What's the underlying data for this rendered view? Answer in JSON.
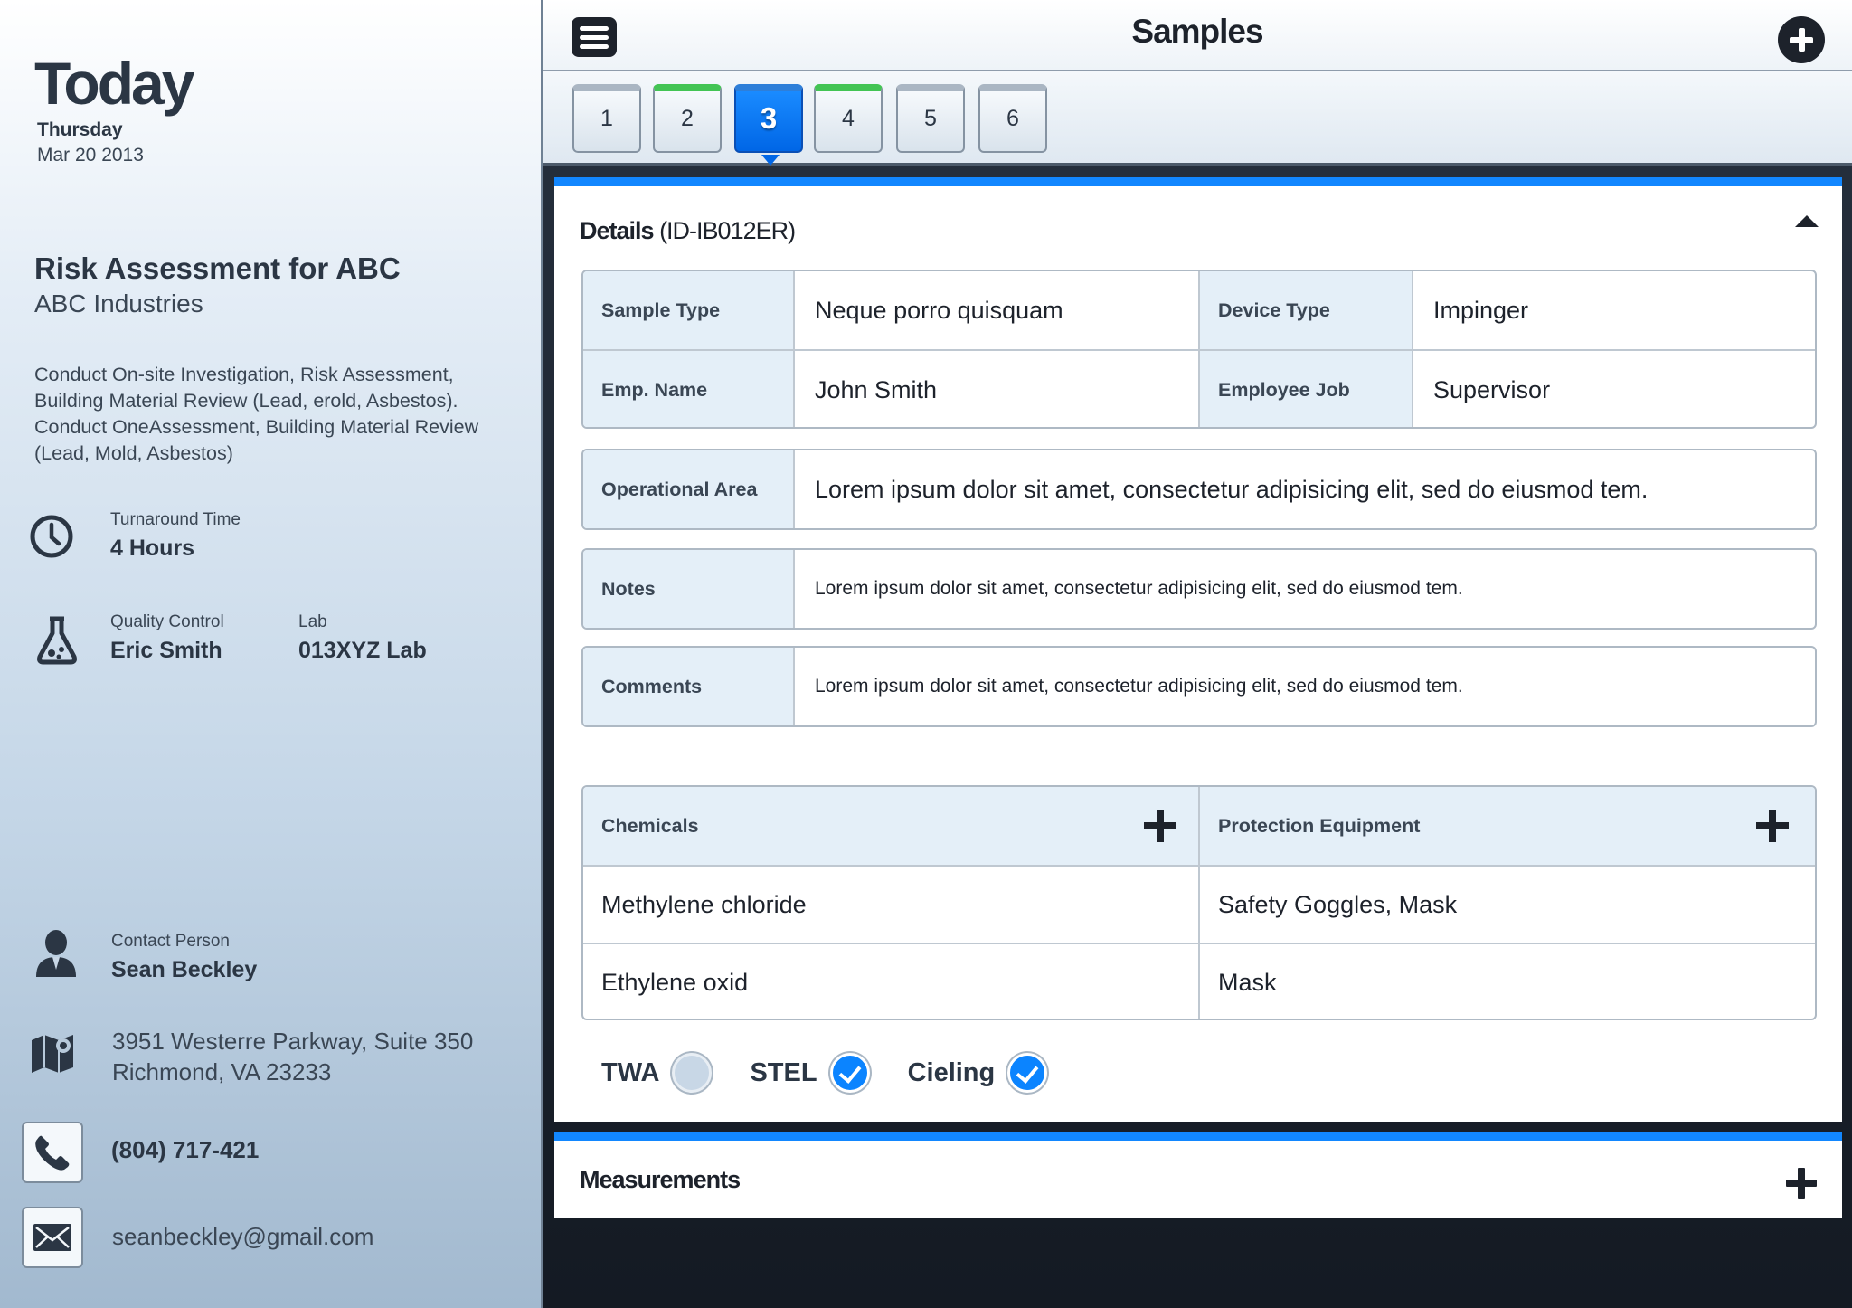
{
  "sidebar": {
    "today": "Today",
    "weekday": "Thursday",
    "date": "Mar 20 2013",
    "project_title": "Risk Assessment for ABC",
    "company": "ABC Industries",
    "description": "Conduct On-site Investigation, Risk Assessment, Building Material Review (Lead, erold, Asbestos). Conduct OneAssessment, Building Material Review (Lead, Mold, Asbestos)",
    "turnaround": {
      "label": "Turnaround Time",
      "value": "4 Hours",
      "icon": "clock-icon"
    },
    "quality_control": {
      "label": "Quality Control",
      "value": "Eric Smith",
      "icon": "flask-icon"
    },
    "lab": {
      "label": "Lab",
      "value": "013XYZ Lab"
    },
    "contact": {
      "label": "Contact Person",
      "value": "Sean Beckley",
      "icon": "person-icon"
    },
    "address_line1": "3951 Westerre Parkway, Suite 350",
    "address_line2": "Richmond, VA 23233",
    "phone": "(804) 717-421",
    "email": "seanbeckley@gmail.com"
  },
  "header": {
    "title": "Samples"
  },
  "tabs": [
    {
      "label": "1",
      "status": "none"
    },
    {
      "label": "2",
      "status": "done"
    },
    {
      "label": "3",
      "status": "active"
    },
    {
      "label": "4",
      "status": "done"
    },
    {
      "label": "5",
      "status": "none"
    },
    {
      "label": "6",
      "status": "none"
    }
  ],
  "details": {
    "title": "Details",
    "id": "(ID-IB012ER)",
    "sample_type_label": "Sample Type",
    "sample_type_value": "Neque porro quisquam",
    "device_type_label": "Device Type",
    "device_type_value": "Impinger",
    "emp_name_label": "Emp. Name",
    "emp_name_value": "John Smith",
    "employee_job_label": "Employee Job",
    "employee_job_value": "Supervisor",
    "operational_area_label": "Operational Area",
    "operational_area_value": "Lorem ipsum dolor sit amet, consectetur adipisicing elit, sed do eiusmod tem.",
    "notes_label": "Notes",
    "notes_value": "Lorem ipsum dolor sit amet, consectetur adipisicing elit, sed do eiusmod tem.",
    "comments_label": "Comments",
    "comments_value": "Lorem ipsum dolor sit amet, consectetur adipisicing elit, sed do eiusmod tem.",
    "chemicals_header": "Chemicals",
    "protection_header": "Protection Equipment",
    "rows": [
      {
        "chemical": "Methylene chloride",
        "protection": "Safety Goggles, Mask"
      },
      {
        "chemical": "Ethylene oxid",
        "protection": "Mask"
      }
    ],
    "checks": [
      {
        "label": "TWA",
        "checked": false
      },
      {
        "label": "STEL",
        "checked": true
      },
      {
        "label": "Cieling",
        "checked": true
      }
    ]
  },
  "measurements": {
    "title": "Measurements"
  },
  "colors": {
    "accent": "#1287ff",
    "done_tab": "#43c454",
    "dark": "#1d222b"
  }
}
